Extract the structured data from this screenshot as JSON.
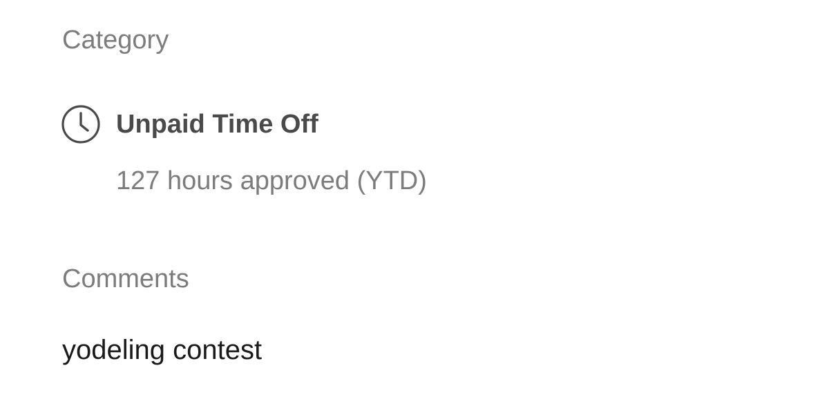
{
  "category": {
    "heading": "Category",
    "icon": "clock-icon",
    "name": "Unpaid Time Off",
    "detail": "127 hours approved (YTD)"
  },
  "comments": {
    "heading": "Comments",
    "text": "yodeling contest"
  },
  "colors": {
    "label_gray": "#7c7c7c",
    "title_dark": "#4a4a4a",
    "body_text": "#1a1a1a"
  }
}
